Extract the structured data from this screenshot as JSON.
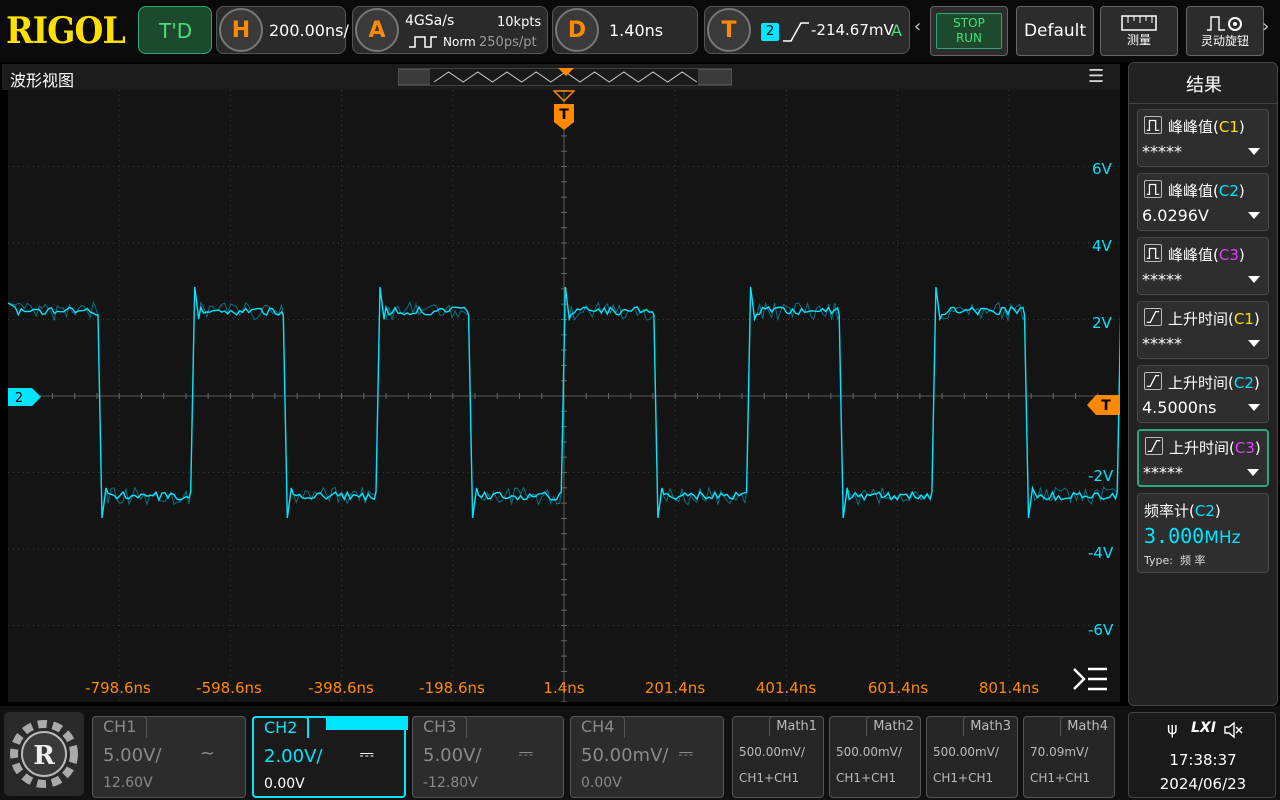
{
  "brand": "RIGOL",
  "status": {
    "label": "T'D"
  },
  "horizontal": {
    "badge": "H",
    "timebase": "200.00ns/"
  },
  "acquire": {
    "badge": "A",
    "sample_rate": "4GSa/s",
    "memory_depth": "10kpts",
    "mode": "Norm",
    "resolution": "250ps/pt"
  },
  "delay": {
    "badge": "D",
    "value": "1.40ns"
  },
  "trigger": {
    "badge": "T",
    "source": "2",
    "level": "-214.67mV",
    "sweep": "A"
  },
  "toolbar": {
    "stop_label": "STOP",
    "run_label": "RUN",
    "default_label": "Default",
    "measure_label": "测量",
    "knob_label": "灵动旋钮"
  },
  "wave_panel": {
    "title": "波形视图",
    "trigger_marker": "T",
    "channel_marker": "2",
    "level_marker": "T"
  },
  "x_ticks": [
    "-798.6ns",
    "-598.6ns",
    "-398.6ns",
    "-198.6ns",
    "1.4ns",
    "201.4ns",
    "401.4ns",
    "601.4ns",
    "801.4ns"
  ],
  "y_ticks": [
    "6V",
    "4V",
    "2V",
    "-2V",
    "-4V",
    "-6V"
  ],
  "results": {
    "title": "结果",
    "measurements": [
      {
        "name": "峰峰值",
        "channel": "C1",
        "value": "*****",
        "icon": "pulse-icon"
      },
      {
        "name": "峰峰值",
        "channel": "C2",
        "value": "6.0296V",
        "icon": "pulse-icon"
      },
      {
        "name": "峰峰值",
        "channel": "C3",
        "value": "*****",
        "icon": "pulse-icon"
      },
      {
        "name": "上升时间",
        "channel": "C1",
        "value": "*****",
        "icon": "rise-icon"
      },
      {
        "name": "上升时间",
        "channel": "C2",
        "value": "4.5000ns",
        "icon": "rise-icon"
      },
      {
        "name": "上升时间",
        "channel": "C3",
        "value": "*****",
        "icon": "rise-icon"
      }
    ],
    "counter": {
      "name": "频率计",
      "channel": "C2",
      "value": "3.000",
      "unit": "MHz",
      "type_label": "Type:",
      "type_value": "频 率"
    }
  },
  "channels": [
    {
      "name": "CH1",
      "scale": "5.00V/",
      "offset": "12.60V",
      "coupling": "~"
    },
    {
      "name": "CH2",
      "scale": "2.00V/",
      "offset": "0.00V",
      "coupling": "⎓"
    },
    {
      "name": "CH3",
      "scale": "5.00V/",
      "offset": "-12.80V",
      "coupling": "⎓"
    },
    {
      "name": "CH4",
      "scale": "50.00mV/",
      "offset": "0.00V",
      "coupling": "⎓"
    }
  ],
  "maths": [
    {
      "name": "Math1",
      "scale": "500.00mV/",
      "expr": "CH1+CH1"
    },
    {
      "name": "Math2",
      "scale": "500.00mV/",
      "expr": "CH1+CH1"
    },
    {
      "name": "Math3",
      "scale": "500.00mV/",
      "expr": "CH1+CH1"
    },
    {
      "name": "Math4",
      "scale": "70.09mV/",
      "expr": "CH1+CH1"
    }
  ],
  "system": {
    "lxi_label": "LXI",
    "time": "17:38:37",
    "date": "2024/06/23"
  },
  "colors": {
    "ch1": "#ffe100",
    "ch2": "#00e5ff",
    "ch3": "#e040fb",
    "orange": "#ff8a00"
  }
}
